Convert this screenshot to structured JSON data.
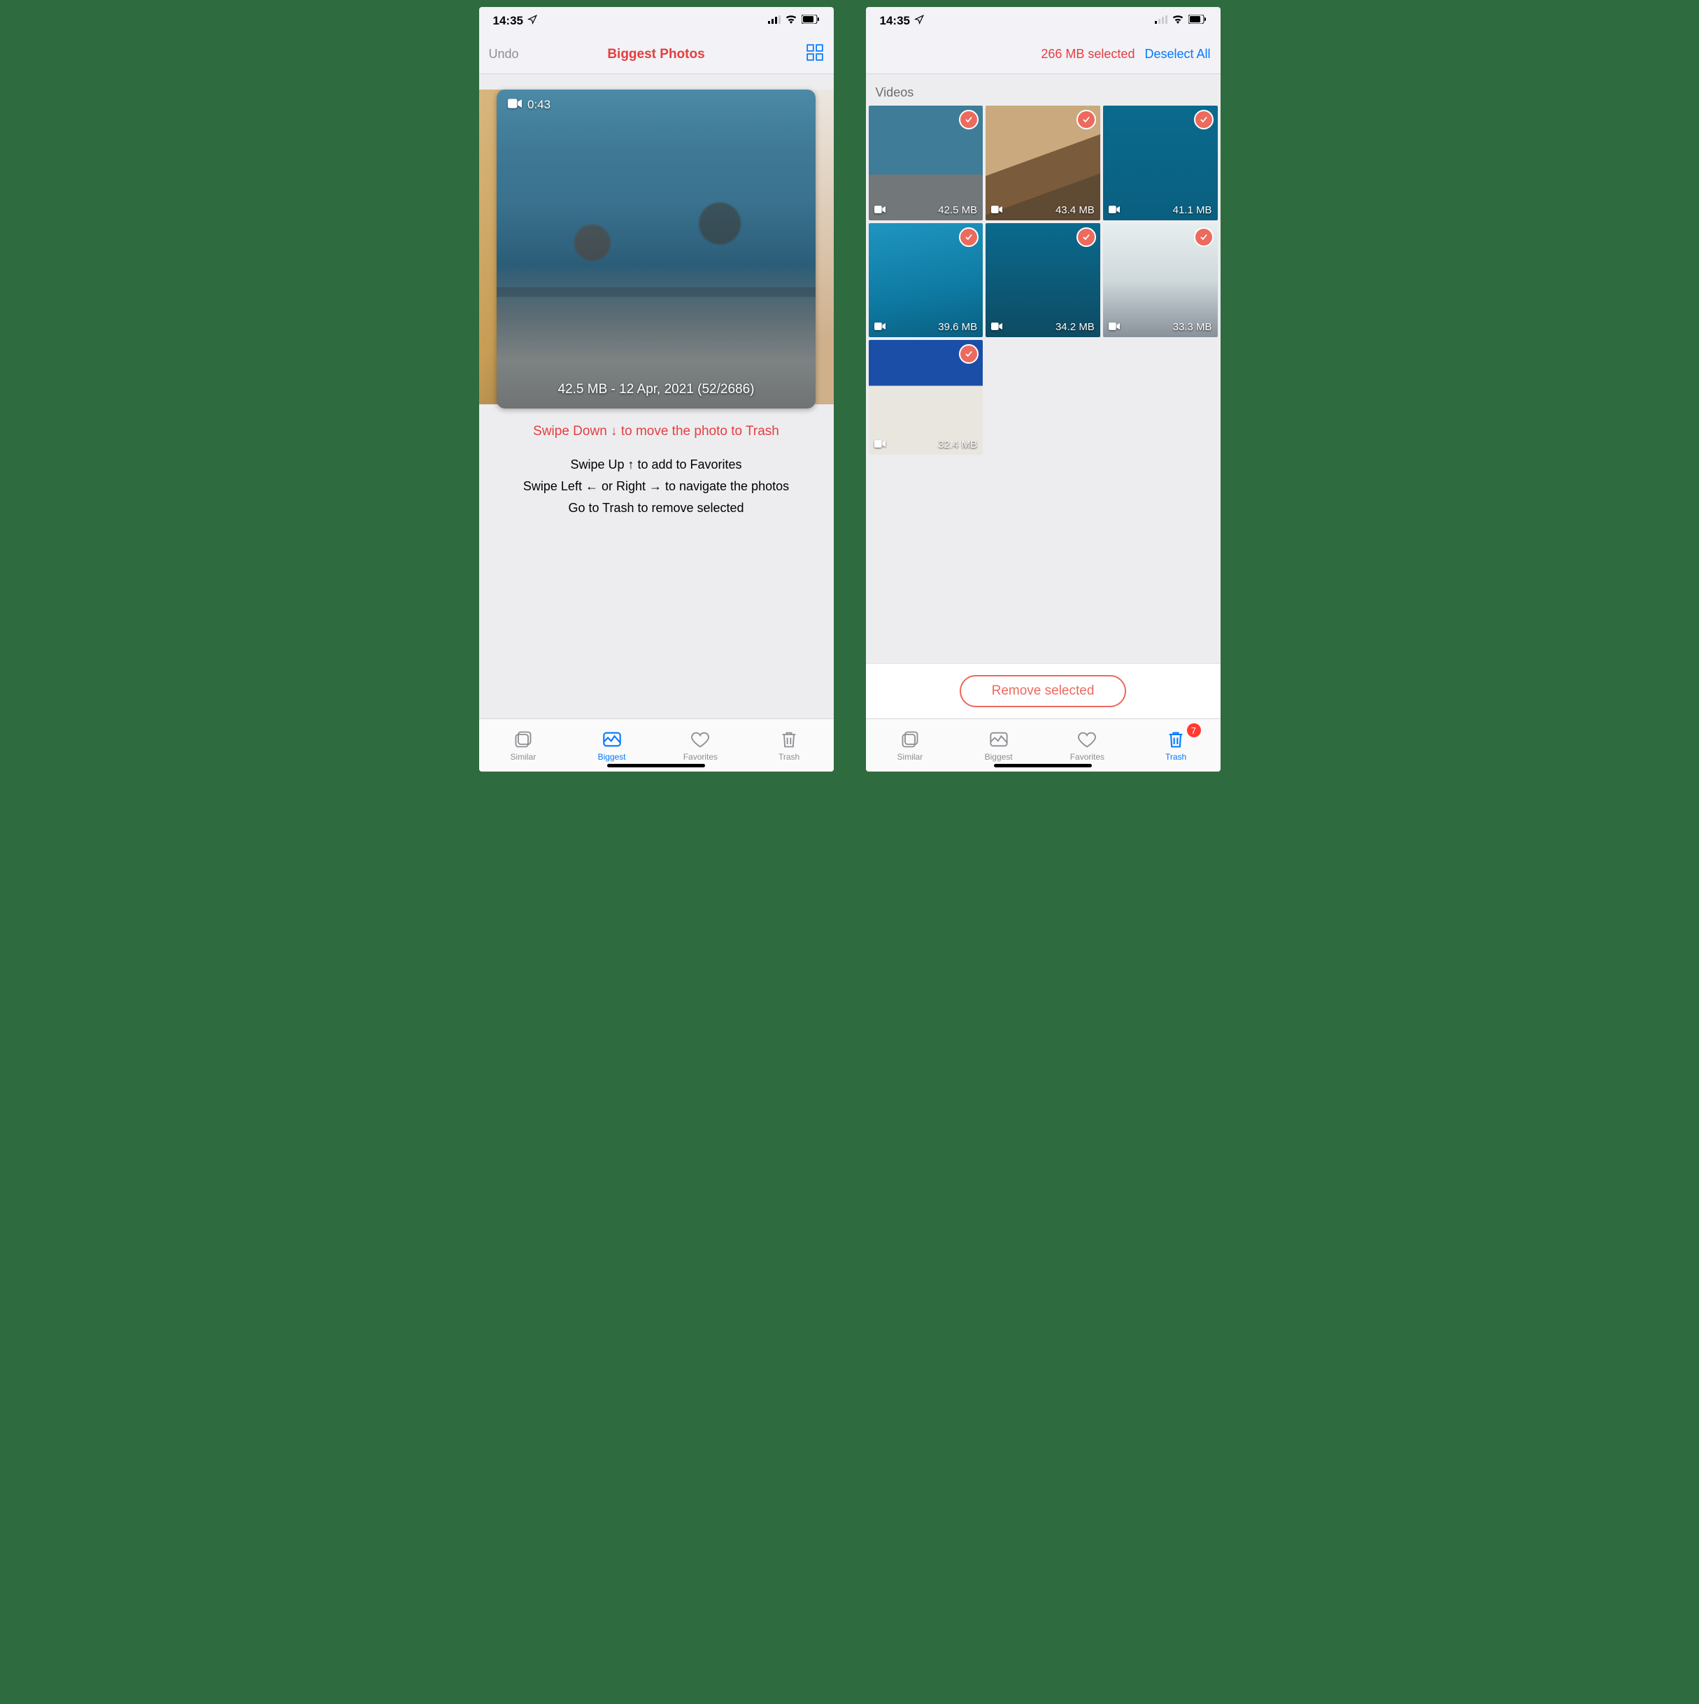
{
  "left": {
    "status": {
      "time": "14:35"
    },
    "nav": {
      "undo": "Undo",
      "title": "Biggest Photos"
    },
    "mainPhoto": {
      "duration": "0:43",
      "caption": "42.5 MB - 12 Apr, 2021 (52/2686)"
    },
    "hints": {
      "trash": "Swipe Down ↓ to move the photo to Trash",
      "fav": "Swipe Up ↑ to add to Favorites",
      "nav": "Swipe Left ← or Right → to navigate the photos",
      "go": "Go to Trash to remove selected"
    },
    "tabs": {
      "similar": "Similar",
      "biggest": "Biggest",
      "favorites": "Favorites",
      "trash": "Trash"
    }
  },
  "right": {
    "status": {
      "time": "14:35"
    },
    "nav": {
      "selected": "266 MB selected",
      "deselect": "Deselect All"
    },
    "sectionTitle": "Videos",
    "thumbs": [
      {
        "size": "42.5 MB"
      },
      {
        "size": "43.4 MB"
      },
      {
        "size": "41.1 MB"
      },
      {
        "size": "39.6 MB"
      },
      {
        "size": "34.2 MB"
      },
      {
        "size": "33.3 MB"
      },
      {
        "size": "32.4 MB"
      }
    ],
    "removeBtn": "Remove selected",
    "trashBadge": "7",
    "tabs": {
      "similar": "Similar",
      "biggest": "Biggest",
      "favorites": "Favorites",
      "trash": "Trash"
    }
  }
}
